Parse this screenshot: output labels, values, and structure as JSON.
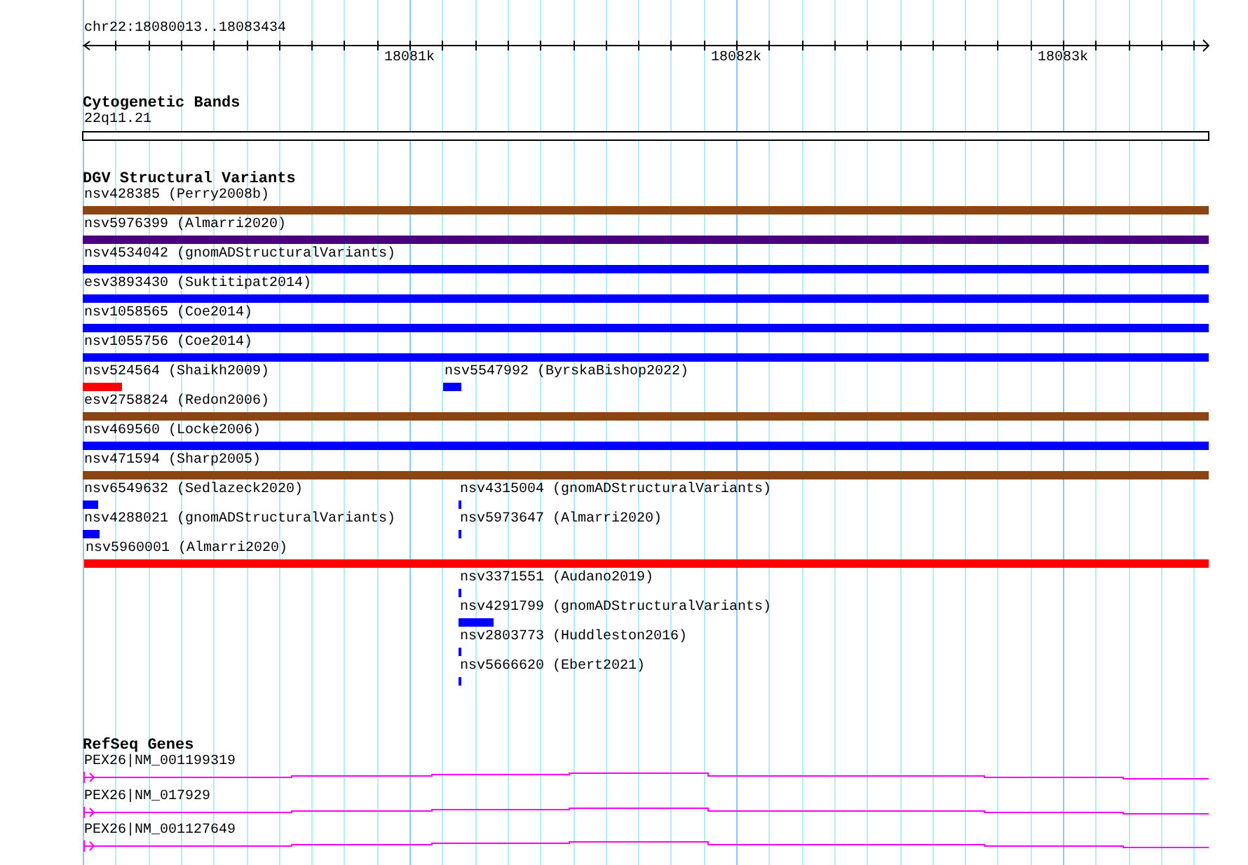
{
  "location": "chr22:18080013..18083434",
  "ruler": {
    "ticks": [
      "18081k",
      "18082k",
      "18083k"
    ]
  },
  "tracks": [
    {
      "kind": "bands",
      "title": "Cytogenetic Bands",
      "features": [
        {
          "label": "22q11.21"
        }
      ]
    },
    {
      "kind": "variants",
      "title": "DGV Structural Variants",
      "features": [
        {
          "label": "nsv428385 (Perry2008b)",
          "color": "#8b4513"
        },
        {
          "label": "nsv5976399 (Almarri2020)",
          "color": "#4b0082"
        },
        {
          "label": "nsv4534042 (gnomADStructuralVariants)",
          "color": "#0000ff"
        },
        {
          "label": "esv3893430 (Suktitipat2014)",
          "color": "#0000ff"
        },
        {
          "label": "nsv1058565 (Coe2014)",
          "color": "#0000ff"
        },
        {
          "label": "nsv1055756 (Coe2014)",
          "color": "#0000ff"
        },
        {
          "label": "nsv524564 (Shaikh2009)",
          "color": "#ff0000"
        },
        {
          "label": "nsv5547992 (ByrskaBishop2022)",
          "color": "#0000ff"
        },
        {
          "label": "esv2758824 (Redon2006)",
          "color": "#8b4513"
        },
        {
          "label": "nsv469560 (Locke2006)",
          "color": "#0000ff"
        },
        {
          "label": "nsv471594 (Sharp2005)",
          "color": "#8b4513"
        },
        {
          "label": "nsv6549632 (Sedlazeck2020)",
          "color": "#0000ff"
        },
        {
          "label": "nsv4315004 (gnomADStructuralVariants)",
          "color": "#0000ff"
        },
        {
          "label": "nsv4288021 (gnomADStructuralVariants)",
          "color": "#0000ff"
        },
        {
          "label": "nsv5973647 (Almarri2020)",
          "color": "#0000ff"
        },
        {
          "label": "nsv5960001 (Almarri2020)",
          "color": "#ff0000"
        },
        {
          "label": "nsv3371551 (Audano2019)",
          "color": "#0000ff"
        },
        {
          "label": "nsv4291799 (gnomADStructuralVariants)",
          "color": "#0000ff"
        },
        {
          "label": "nsv2803773 (Huddleston2016)",
          "color": "#0000ff"
        },
        {
          "label": "nsv5666620 (Ebert2021)",
          "color": "#0000ff"
        }
      ]
    },
    {
      "kind": "genes",
      "title": "RefSeq Genes",
      "features": [
        {
          "label": "PEX26|NM_001199319"
        },
        {
          "label": "PEX26|NM_017929"
        },
        {
          "label": "PEX26|NM_001127649"
        }
      ]
    }
  ]
}
